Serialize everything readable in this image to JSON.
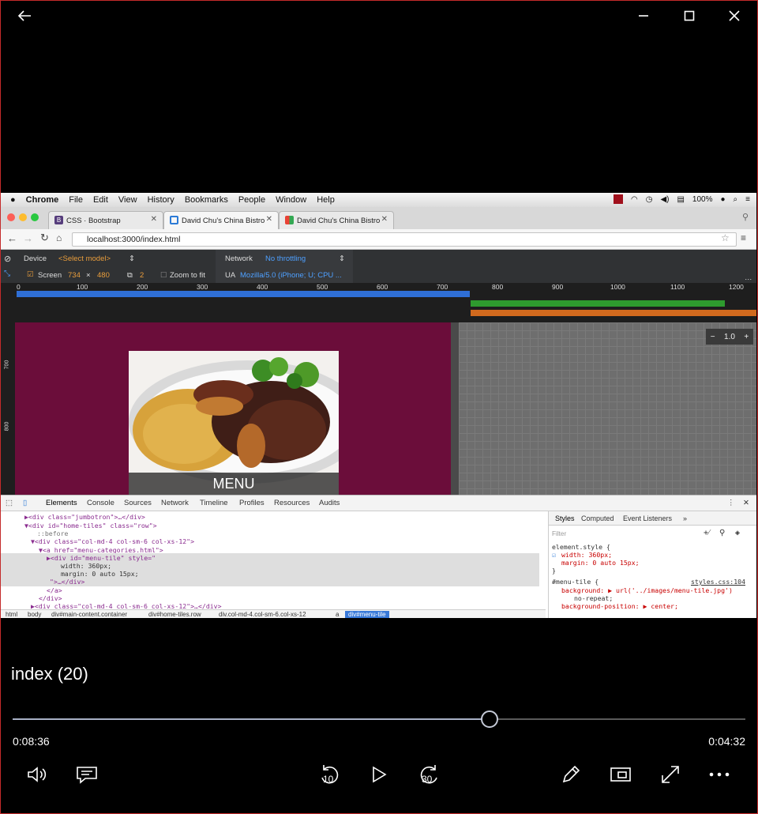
{
  "player": {
    "title": "index (20)",
    "elapsed": "0:08:36",
    "remaining": "0:04:32",
    "progress": 0.651,
    "skip_back_seconds": "10",
    "skip_forward_seconds": "30",
    "icons": [
      "back-arrow-icon",
      "minimize-icon",
      "maximize-icon",
      "close-icon",
      "volume-icon",
      "captions-icon",
      "skip-back-10-icon",
      "play-icon",
      "skip-forward-30-icon",
      "edit-icon",
      "mini-view-icon",
      "fullscreen-icon",
      "more-icon"
    ]
  },
  "mac_menubar": {
    "items": [
      "Chrome",
      "File",
      "Edit",
      "View",
      "History",
      "Bookmarks",
      "People",
      "Window",
      "Help"
    ],
    "battery": "100%"
  },
  "browser": {
    "tabs": [
      {
        "label": "CSS · Bootstrap",
        "badge": "B"
      },
      {
        "label": "David Chu's China Bistro"
      },
      {
        "label": "David Chu's China Bistro"
      }
    ],
    "url": "localhost:3000/index.html"
  },
  "emulation": {
    "device_label": "Device",
    "device_select": "<Select model>",
    "network_label": "Network",
    "network_select": "No throttling",
    "screen_label": "Screen",
    "screen_width": "734",
    "screen_x": "×",
    "screen_height": "480",
    "dpr": "2",
    "zoom_to_fit": "Zoom to fit",
    "ua_label": "UA",
    "ua_value": "Mozilla/5.0 (iPhone; U; CPU ...",
    "ruler_labels": [
      "0",
      "100",
      "200",
      "300",
      "400",
      "500",
      "600",
      "700",
      "800",
      "900",
      "1000",
      "1100",
      "1200"
    ],
    "vruler_labels": [
      "700",
      "800"
    ],
    "zoom_value": "1.0",
    "zoom_minus": "−",
    "zoom_plus": "+"
  },
  "page_preview": {
    "menu_tile_label": "MENU"
  },
  "devtools": {
    "tabs": [
      "Elements",
      "Console",
      "Sources",
      "Network",
      "Timeline",
      "Profiles",
      "Resources",
      "Audits"
    ],
    "dom_lines": [
      "▶<div class=\"jumbotron\">…</div>",
      "▼<div id=\"home-tiles\" class=\"row\">",
      "::before",
      "▼<div class=\"col-md-4 col-sm-6 col-xs-12\">",
      "▼<a href=\"menu-categories.html\">",
      "▶<div id=\"menu-tile\" style=\"",
      "width: 360px;",
      "margin: 0 auto 15px;",
      "\">…</div>",
      "</a>",
      "</div>",
      "▶<div class=\"col-md-4 col-sm-6 col-xs-12\">…</div>"
    ],
    "breadcrumbs": [
      "html",
      "body",
      "div#main-content.container",
      "div#home-tiles.row",
      "div.col-md-4.col-sm-6.col-xs-12",
      "a",
      "div#menu-tile"
    ],
    "styles_tabs": [
      "Styles",
      "Computed",
      "Event Listeners",
      "»"
    ],
    "filter_placeholder": "Filter",
    "styles_lines": [
      "element.style {",
      "width: 360px;",
      "margin: 0 auto 15px;",
      "}",
      "#menu-tile {",
      "styles.css:104",
      "background: ▶ url('../images/menu-tile.jpg')",
      "no-repeat;",
      "background-position: ▶ center;"
    ]
  }
}
